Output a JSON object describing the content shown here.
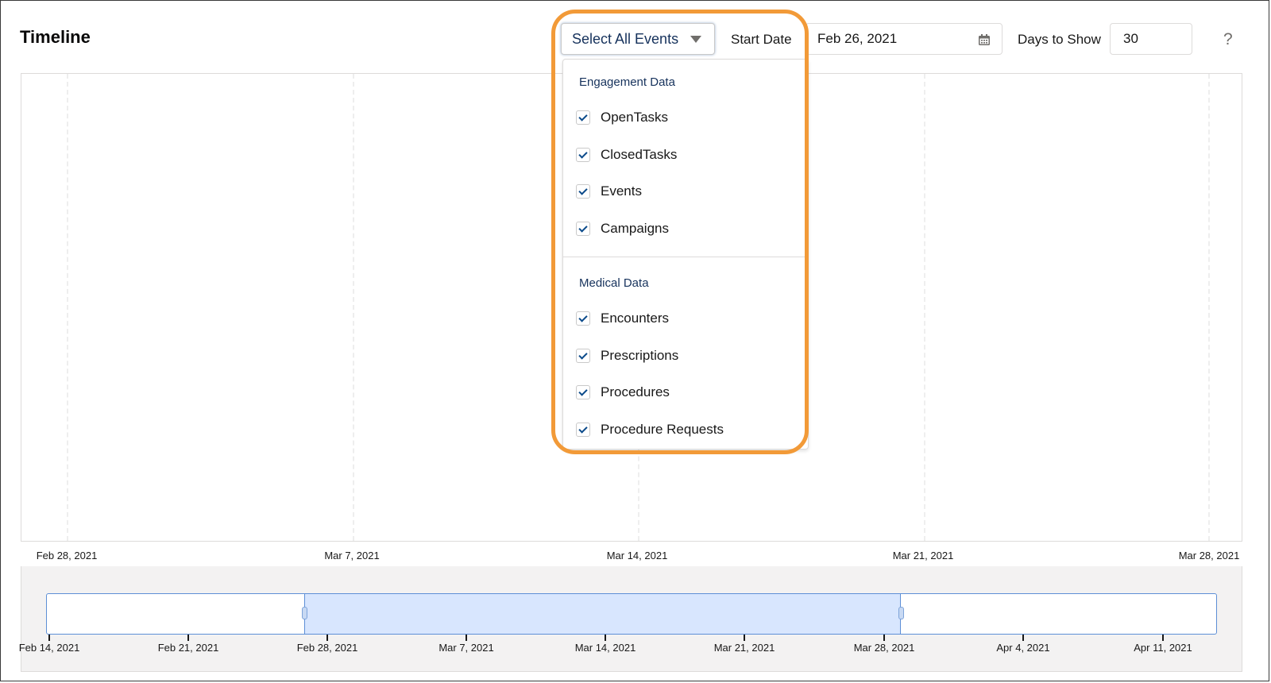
{
  "header": {
    "title": "Timeline",
    "filter_button_label": "Select All Events",
    "start_date_label": "Start Date",
    "start_date_value": "Feb 26, 2021",
    "days_label": "Days to Show",
    "days_value": "30",
    "help_label": "?"
  },
  "dropdown": {
    "groups": [
      {
        "title": "Engagement Data",
        "options": [
          {
            "label": "OpenTasks",
            "checked": true
          },
          {
            "label": "ClosedTasks",
            "checked": true
          },
          {
            "label": "Events",
            "checked": true
          },
          {
            "label": "Campaigns",
            "checked": true
          }
        ]
      },
      {
        "title": "Medical Data",
        "options": [
          {
            "label": "Encounters",
            "checked": true
          },
          {
            "label": "Prescriptions",
            "checked": true
          },
          {
            "label": "Procedures",
            "checked": true
          },
          {
            "label": "Procedure Requests",
            "checked": true
          }
        ]
      }
    ]
  },
  "timeline": {
    "axis_labels": [
      "Feb 28, 2021",
      "Mar 7, 2021",
      "Mar 14, 2021",
      "Mar 21, 2021",
      "Mar 28, 2021"
    ]
  },
  "navigator": {
    "axis_labels": [
      "Feb 14, 2021",
      "Feb 21, 2021",
      "Feb 28, 2021",
      "Mar 7, 2021",
      "Mar 14, 2021",
      "Mar 21, 2021",
      "Mar 28, 2021",
      "Apr 4, 2021",
      "Apr 11, 2021"
    ]
  },
  "colors": {
    "highlight": "#f29a38",
    "selection": "#d8e6fe",
    "selection_border": "#5d8fd6"
  },
  "icons": {
    "calendar": "calendar-icon",
    "caret": "chevron-down-icon"
  }
}
